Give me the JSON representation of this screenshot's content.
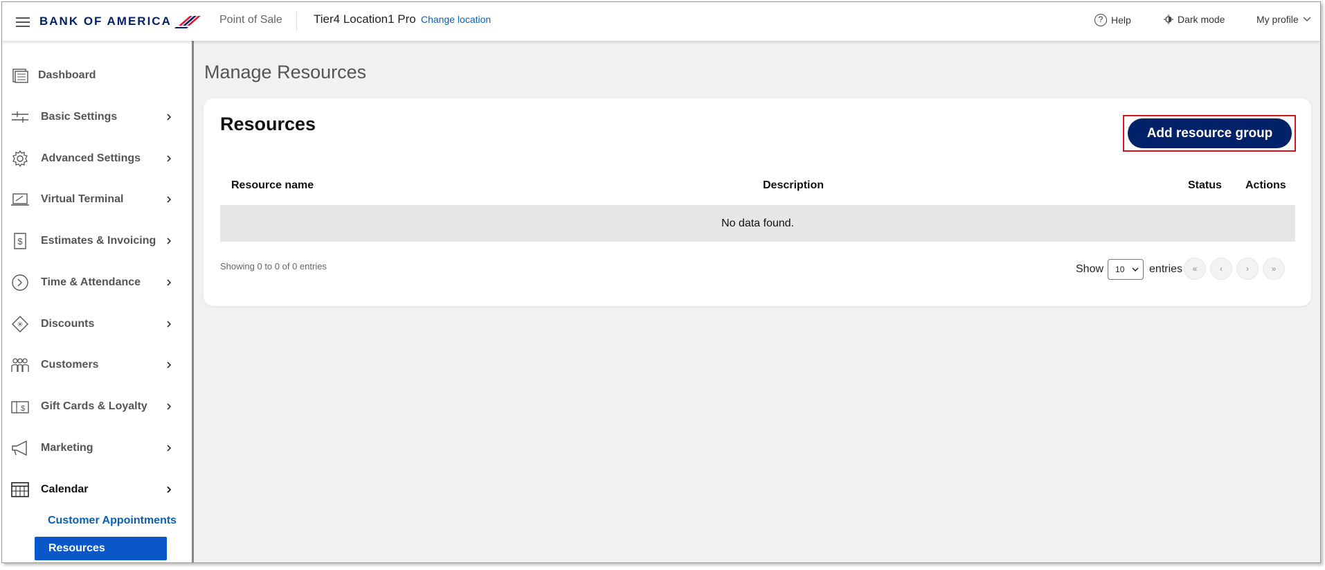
{
  "header": {
    "brand": "BANK OF AMERICA",
    "app_name": "Point of Sale",
    "location": "Tier4 Location1 Pro",
    "change_location": "Change location",
    "help": "Help",
    "dark_mode": "Dark mode",
    "profile": "My profile"
  },
  "sidebar": {
    "items": [
      {
        "label": "Dashboard"
      },
      {
        "label": "Basic Settings"
      },
      {
        "label": "Advanced Settings"
      },
      {
        "label": "Virtual Terminal"
      },
      {
        "label": "Estimates & Invoicing"
      },
      {
        "label": "Time & Attendance"
      },
      {
        "label": "Discounts"
      },
      {
        "label": "Customers"
      },
      {
        "label": "Gift Cards & Loyalty"
      },
      {
        "label": "Marketing"
      },
      {
        "label": "Calendar"
      }
    ],
    "calendar_sub": {
      "appointments": "Customer Appointments",
      "resources": "Resources"
    }
  },
  "main": {
    "page_title": "Manage Resources",
    "card_title": "Resources",
    "add_button": "Add resource group",
    "columns": [
      "Resource name",
      "Description",
      "Status",
      "Actions"
    ],
    "empty_message": "No data found.",
    "showing": "Showing 0 to 0 of 0 entries",
    "show_label": "Show",
    "page_length": "10",
    "entries_label": "entries",
    "pagination": [
      "«",
      "‹",
      "›",
      "»"
    ]
  },
  "colors": {
    "brand_navy": "#012169",
    "brand_red": "#e31837",
    "link_blue": "#0a5fb4",
    "active_sub_bg": "#0a57c9",
    "highlight_border": "#d8141b"
  }
}
